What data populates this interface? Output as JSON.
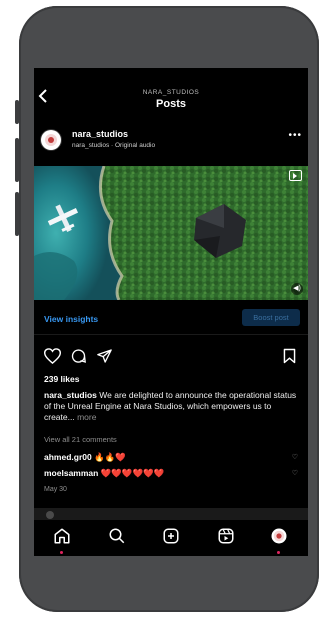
{
  "header": {
    "subtitle": "NARA_STUDIOS",
    "title": "Posts"
  },
  "post": {
    "username": "nara_studios",
    "subline": "nara_studios · Original audio",
    "insights_label": "View insights",
    "boost_label": "Boost post",
    "likes": "239 likes",
    "caption_user": "nara_studios",
    "caption_text": " We are delighted to announce the operational status of the Unreal Engine at Nara Studios, which empowers us to create...",
    "caption_more": " more",
    "view_comments": "View all 21 comments",
    "comments": [
      {
        "user": "ahmed.gr00",
        "text": " 🔥🔥❤️"
      },
      {
        "user": "moelsamman",
        "text": " ❤️❤️❤️❤️❤️❤️"
      }
    ],
    "date": "May 30"
  },
  "icons": {
    "back": "chevron-left-icon",
    "more": "more-horizontal-icon",
    "reel": "reel-icon",
    "mute": "mute-icon",
    "like": "heart-icon",
    "comment": "comment-icon",
    "share": "send-icon",
    "save": "bookmark-icon",
    "nav": [
      "home-icon",
      "search-icon",
      "create-icon",
      "reels-icon",
      "profile-icon"
    ]
  },
  "colors": {
    "accent": "#3897f0",
    "notification": "#e0245e",
    "background": "#000000",
    "phone": "#4a4b4d"
  }
}
